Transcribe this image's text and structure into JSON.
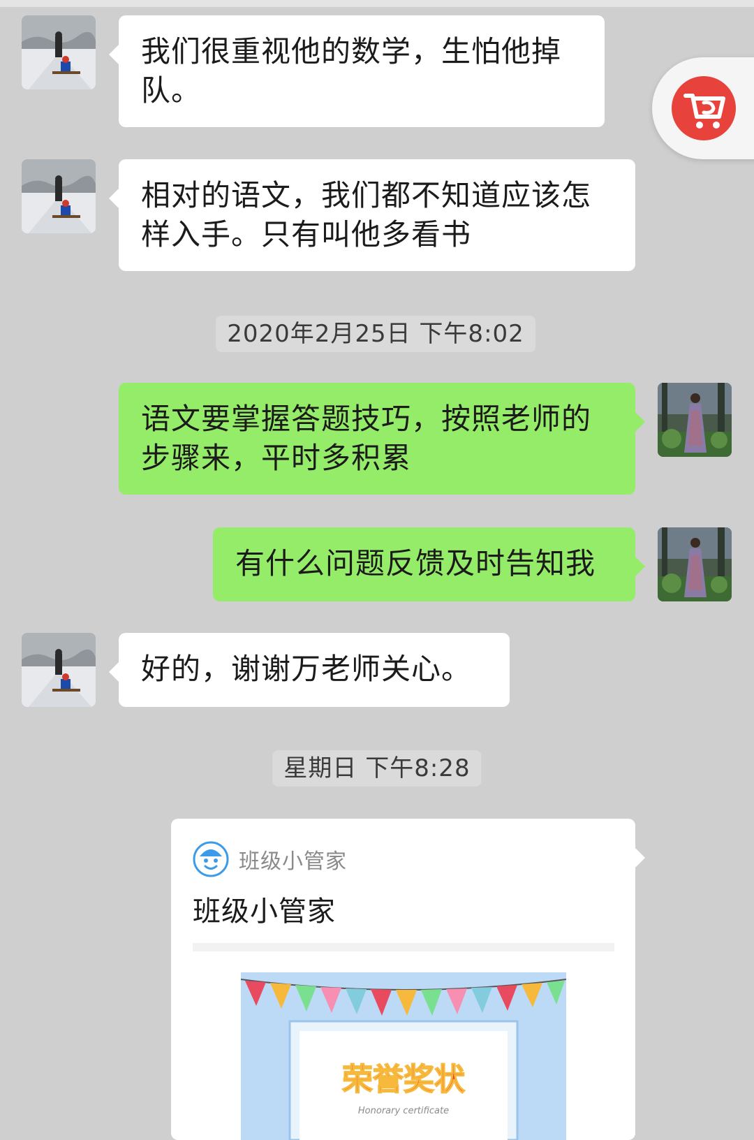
{
  "conversation": {
    "messages": [
      {
        "id": "m1",
        "sender": "parent",
        "direction": "incoming",
        "text_lines": [
          "我们很重视他的数学，生怕他掉",
          "队。"
        ]
      },
      {
        "id": "m2",
        "sender": "parent",
        "direction": "incoming",
        "text_lines": [
          "相对的语文，我们都不知道应该怎",
          "样入手。只有叫他多看书"
        ]
      },
      {
        "id": "m3",
        "sender": "teacher",
        "direction": "outgoing",
        "text_lines": [
          "语文要掌握答题技巧，按照老师的",
          "步骤来，平时多积累"
        ]
      },
      {
        "id": "m4",
        "sender": "teacher",
        "direction": "outgoing",
        "text_lines": [
          "有什么问题反馈及时告知我"
        ]
      },
      {
        "id": "m5",
        "sender": "parent",
        "direction": "incoming",
        "text_lines": [
          "好的，谢谢万老师关心。"
        ]
      }
    ],
    "timestamps": [
      "2020年2月25日 下午8:02",
      "星期日 下午8:28"
    ],
    "share_card": {
      "source_name": "班级小管家",
      "title": "班级小管家",
      "image_title": "荣誉奖状",
      "image_subtitle": "Honorary certificate"
    }
  },
  "icons": {
    "floating_button": "shopping-cart-return-icon",
    "card_logo": "smiley-face-logo-icon"
  },
  "colors": {
    "background": "#cfcfcf",
    "incoming_bubble": "#ffffff",
    "outgoing_bubble": "#95ec69",
    "timestamp_bg": "#dadada",
    "accent_red": "#e8423c"
  }
}
